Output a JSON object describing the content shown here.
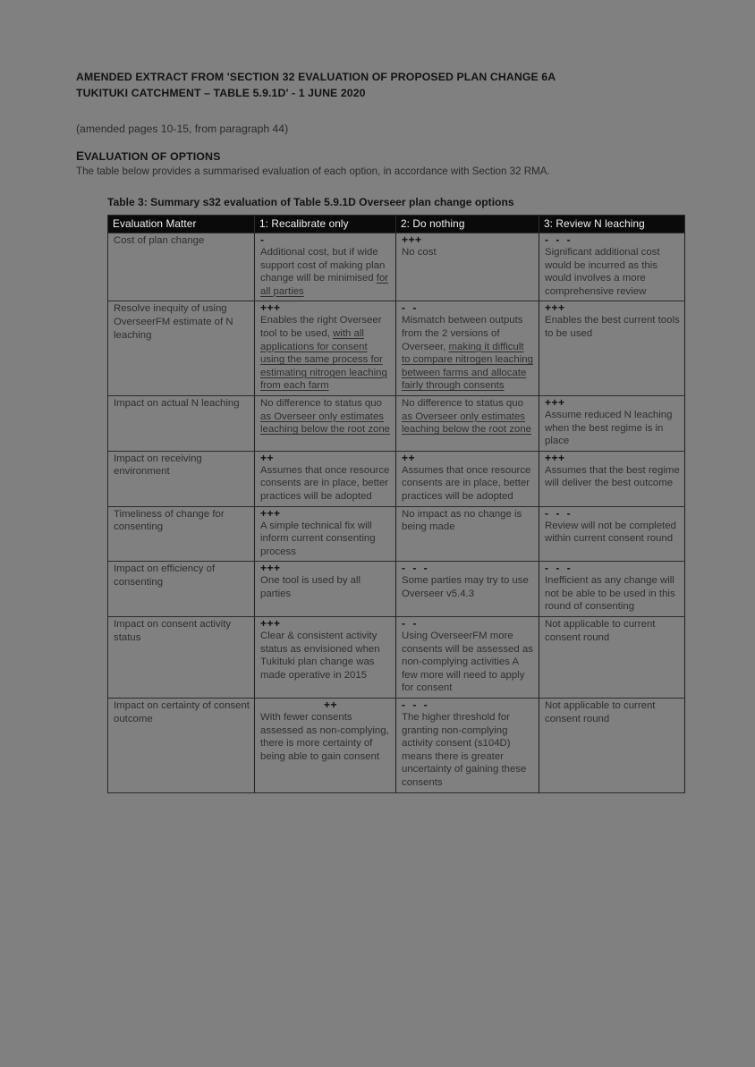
{
  "document": {
    "title_line1": "AMENDED EXTRACT FROM 'SECTION 32 EVALUATION OF PROPOSED PLAN CHANGE 6A",
    "title_line2": "TUKITUKI CATCHMENT – TABLE 5.9.1D' - 1 JUNE 2020",
    "amendment_note": "(amended pages 10-15, from paragraph 44)",
    "section_heading": "EVALUATION OF OPTIONS",
    "section_heading_initial": "E",
    "section_heading_rest": "VALUATION OF OPTIONS",
    "section_intro": "The table below provides a summarised evaluation of each option, in accordance with Section 32 RMA.",
    "table_caption": "Table 3: Summary s32 evaluation of Table 5.9.1D Overseer plan change options"
  },
  "table": {
    "headers": [
      "Evaluation Matter",
      "1: Recalibrate only",
      "2: Do nothing",
      "3: Review N leaching"
    ],
    "rows": [
      {
        "matter": "Cost of plan change",
        "cells": [
          {
            "rating": "-",
            "text_before": "Additional cost, but if wide support cost of making plan change will be minimised ",
            "text_inserted": "for all parties",
            "text_after": ""
          },
          {
            "rating": "+++",
            "text_before": "No cost",
            "text_inserted": "",
            "text_after": ""
          },
          {
            "rating": "- - -",
            "text_before": "Significant additional cost would be incurred as this would involves a more comprehensive review",
            "text_inserted": "",
            "text_after": ""
          }
        ]
      },
      {
        "matter": "Resolve inequity of using OverseerFM estimate of N leaching",
        "cells": [
          {
            "rating": "+++",
            "text_before": "Enables the right Overseer tool to be used, ",
            "text_inserted": "with all applications for consent using the same process for estimating nitrogen leaching from each farm",
            "text_after": ""
          },
          {
            "rating": "- -",
            "text_before": "Mismatch between outputs from the 2 versions of Overseer, ",
            "text_inserted": "making it difficult to compare nitrogen leaching between farms and allocate fairly through consents",
            "text_after": ""
          },
          {
            "rating": "+++",
            "text_before": "Enables the best current tools to be used",
            "text_inserted": "",
            "text_after": ""
          }
        ]
      },
      {
        "matter": "Impact on actual N leaching",
        "cells": [
          {
            "rating": "",
            "text_before": "No difference to status quo ",
            "text_inserted": "as Overseer only estimates leaching below the root zone",
            "text_after": ""
          },
          {
            "rating": "",
            "text_before": "No difference to status quo ",
            "text_inserted": "as Overseer only estimates leaching below the root zone",
            "text_after": ""
          },
          {
            "rating": "+++",
            "text_before": "Assume reduced N leaching when the best regime is in place",
            "text_inserted": "",
            "text_after": ""
          }
        ]
      },
      {
        "matter": "Impact on receiving environment",
        "cells": [
          {
            "rating": "++",
            "text_before": "Assumes that once resource consents are in place, better practices will be adopted",
            "text_inserted": "",
            "text_after": ""
          },
          {
            "rating": "++",
            "text_before": "Assumes that once resource consents are in place, better practices will be adopted",
            "text_inserted": "",
            "text_after": ""
          },
          {
            "rating": "+++",
            "text_before": "Assumes that the best regime will deliver the best outcome",
            "text_inserted": "",
            "text_after": ""
          }
        ]
      },
      {
        "matter": "Timeliness of change for consenting",
        "cells": [
          {
            "rating": "+++",
            "text_before": "A simple technical fix will inform current consenting process",
            "text_inserted": "",
            "text_after": ""
          },
          {
            "rating": "",
            "text_before": "No impact as no change is being made",
            "text_inserted": "",
            "text_after": ""
          },
          {
            "rating": "- - -",
            "text_before": "Review will not be completed within current consent round",
            "text_inserted": "",
            "text_after": ""
          }
        ]
      },
      {
        "matter": "Impact on efficiency of consenting",
        "cells": [
          {
            "rating": "+++",
            "text_before": "One tool is used by all parties",
            "text_inserted": "",
            "text_after": ""
          },
          {
            "rating": "- - -",
            "text_before": "Some parties may try to use Overseer v5.4.3",
            "text_inserted": "",
            "text_after": ""
          },
          {
            "rating": "- - -",
            "text_before": "Inefficient as any change will not be able to be used in this round of consenting",
            "text_inserted": "",
            "text_after": ""
          }
        ]
      },
      {
        "matter": "Impact on consent activity status",
        "cells": [
          {
            "rating": "+++",
            "text_before": "Clear & consistent activity status as envisioned when Tukituki plan change was made operative in 2015",
            "text_inserted": "",
            "text_after": ""
          },
          {
            "rating": "- -",
            "text_before": "Using OverseerFM more consents will be assessed as non-complying activities A few more will need to apply for consent",
            "text_inserted": "",
            "text_after": ""
          },
          {
            "rating": "",
            "text_before": "Not applicable to current consent round",
            "text_inserted": "",
            "text_after": ""
          }
        ]
      },
      {
        "matter": "Impact on certainty of consent outcome",
        "cells": [
          {
            "rating": "++",
            "rating_centered": true,
            "text_before": "With fewer consents assessed as non-complying, there is more certainty of being able to gain consent",
            "text_inserted": "",
            "text_after": ""
          },
          {
            "rating": "- - -",
            "text_before": "The higher threshold for granting non-complying activity consent (s104D) means there is greater uncertainty of gaining these consents",
            "text_inserted": "",
            "text_after": ""
          },
          {
            "rating": "",
            "text_before": "Not applicable to current consent round",
            "text_inserted": "",
            "text_after": ""
          }
        ]
      }
    ]
  },
  "colors": {
    "page_background": "#808080",
    "header_row_background": "#0a0a0a",
    "header_row_text": "#f2f2f2",
    "body_text": "#2e2e2e",
    "border": "#2b2b2b"
  }
}
